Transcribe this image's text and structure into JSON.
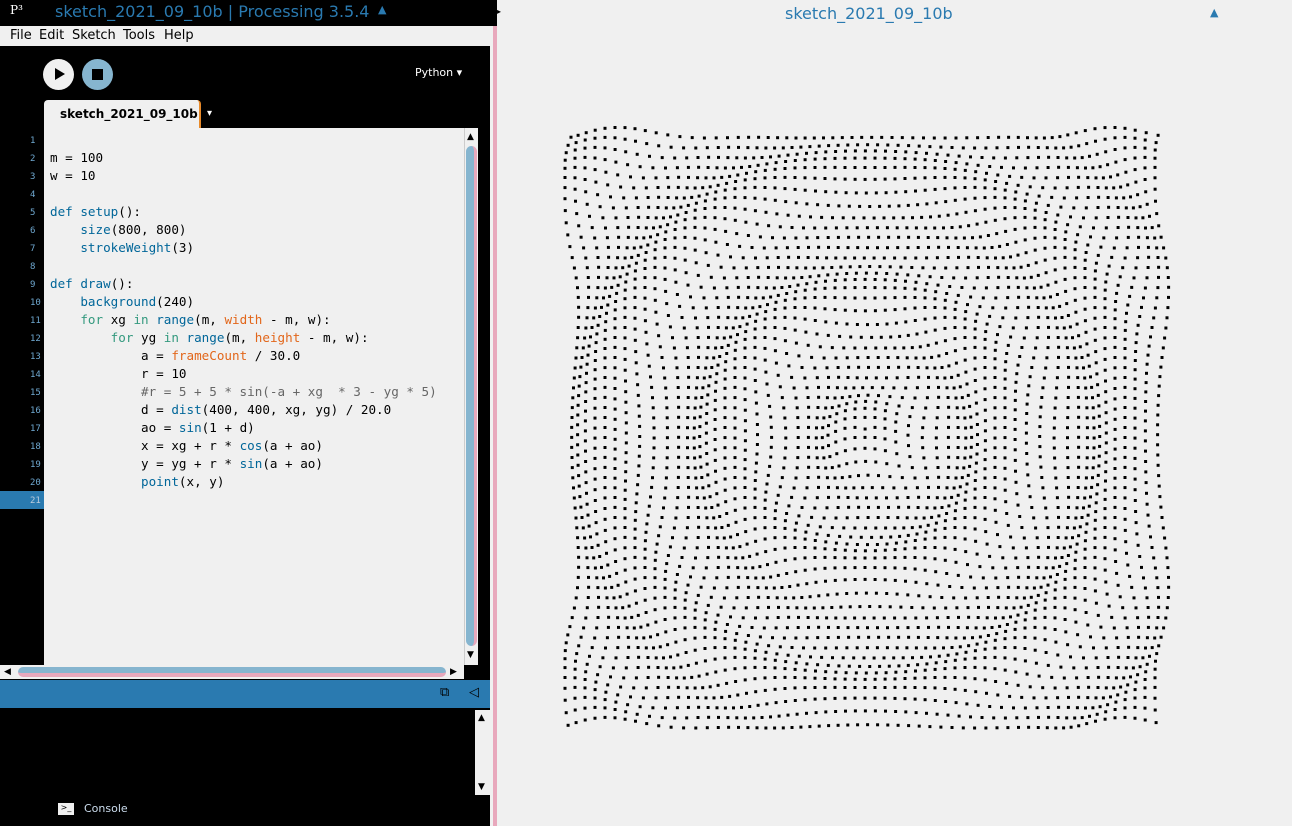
{
  "window": {
    "title": "sketch_2021_09_10b | Processing 3.5.4",
    "logo": "P3"
  },
  "menu": [
    "File",
    "Edit",
    "Sketch",
    "Tools",
    "Help"
  ],
  "toolbar": {
    "mode": "Python ▾",
    "run": "run",
    "stop": "stop"
  },
  "tab": {
    "label": "sketch_2021_09_10b",
    "arrow": "▾"
  },
  "editor": {
    "current_line": 21,
    "lines": [
      [],
      [
        [
          "m = 100",
          ""
        ]
      ],
      [
        [
          "w = 10",
          ""
        ]
      ],
      [],
      [
        [
          "def ",
          "kw2"
        ],
        [
          "setup",
          "fn"
        ],
        [
          "():",
          ""
        ]
      ],
      [
        [
          "    ",
          ""
        ],
        [
          "size",
          "fn"
        ],
        [
          "(800, 800)",
          ""
        ]
      ],
      [
        [
          "    ",
          ""
        ],
        [
          "strokeWeight",
          "fn"
        ],
        [
          "(3)",
          ""
        ]
      ],
      [],
      [
        [
          "def ",
          "kw2"
        ],
        [
          "draw",
          "fn"
        ],
        [
          "():",
          ""
        ]
      ],
      [
        [
          "    ",
          ""
        ],
        [
          "background",
          "fn"
        ],
        [
          "(240)",
          ""
        ]
      ],
      [
        [
          "    ",
          ""
        ],
        [
          "for ",
          "kw"
        ],
        [
          "xg ",
          ""
        ],
        [
          "in ",
          "kw"
        ],
        [
          "range",
          "fn"
        ],
        [
          "(m, ",
          ""
        ],
        [
          "width",
          "const"
        ],
        [
          " - m, w):",
          ""
        ]
      ],
      [
        [
          "        ",
          ""
        ],
        [
          "for ",
          "kw"
        ],
        [
          "yg ",
          ""
        ],
        [
          "in ",
          "kw"
        ],
        [
          "range",
          "fn"
        ],
        [
          "(m, ",
          ""
        ],
        [
          "height",
          "const"
        ],
        [
          " - m, w):",
          ""
        ]
      ],
      [
        [
          "            a = ",
          ""
        ],
        [
          "frameCount",
          "const"
        ],
        [
          " / 30.0",
          ""
        ]
      ],
      [
        [
          "            r = 10",
          ""
        ]
      ],
      [
        [
          "            #r = 5 + 5 * sin(-a + xg  * 3 - yg * 5)",
          "cm"
        ]
      ],
      [
        [
          "            d = ",
          ""
        ],
        [
          "dist",
          "fn"
        ],
        [
          "(400, 400, xg, yg) / 20.0",
          ""
        ]
      ],
      [
        [
          "            ao = ",
          ""
        ],
        [
          "sin",
          "fn"
        ],
        [
          "(1 + d)",
          ""
        ]
      ],
      [
        [
          "            x = xg + r * ",
          ""
        ],
        [
          "cos",
          "fn"
        ],
        [
          "(a + ao)",
          ""
        ]
      ],
      [
        [
          "            y = yg + r * ",
          ""
        ],
        [
          "sin",
          "fn"
        ],
        [
          "(a + ao)",
          ""
        ]
      ],
      [
        [
          "            ",
          ""
        ],
        [
          "point",
          "fn"
        ],
        [
          "(x, y)",
          ""
        ]
      ],
      []
    ]
  },
  "console": {
    "label": "Console"
  },
  "sketch": {
    "title": "sketch_2021_09_10b",
    "background": "#f0f0f0",
    "m": 100,
    "w": 10,
    "r": 10,
    "size": 800
  },
  "colors": {
    "accent": "#2a7ab0",
    "pink": "#e8a8bc"
  }
}
